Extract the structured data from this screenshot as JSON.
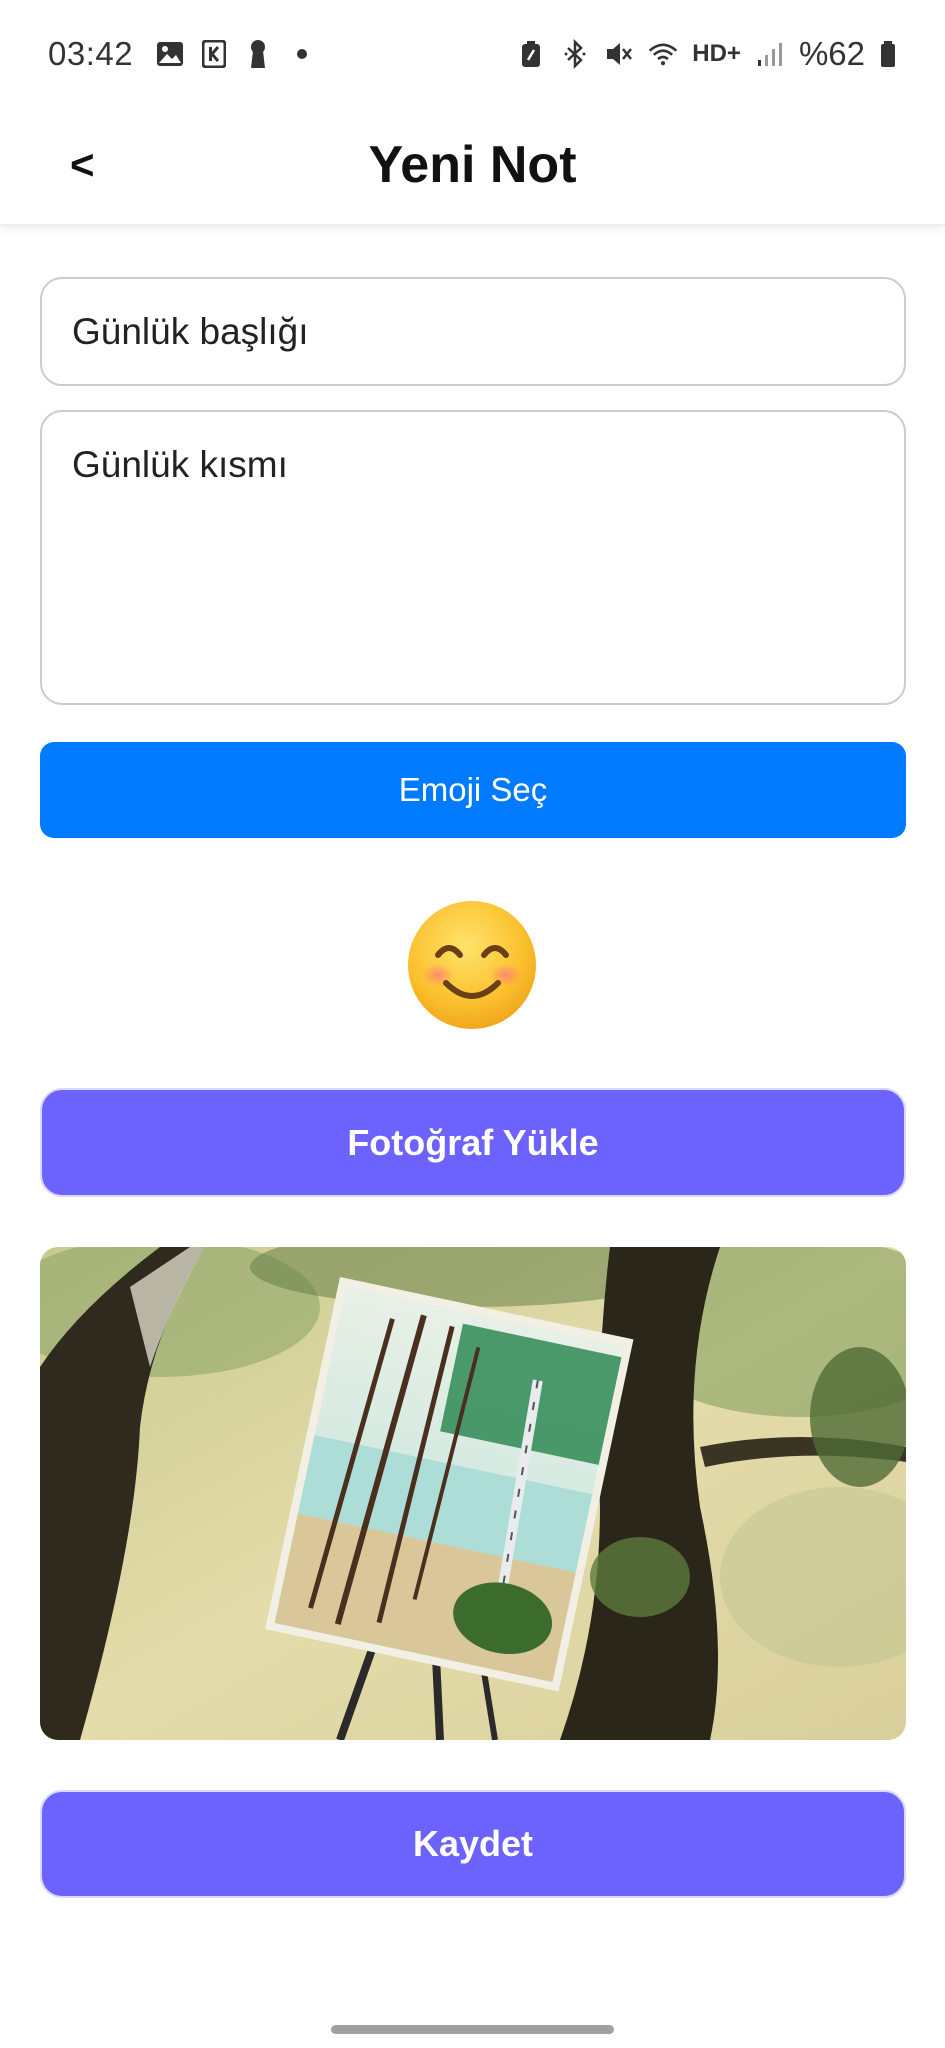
{
  "status_bar": {
    "time": "03:42",
    "battery": "%62",
    "hd_label": "HD+"
  },
  "header": {
    "back_label": "<",
    "title": "Yeni Not"
  },
  "form": {
    "title_placeholder": "Günlük başlığı",
    "body_placeholder": "Günlük kısmı"
  },
  "buttons": {
    "emoji": "Emoji Seç",
    "upload": "Fotoğraf Yükle",
    "save": "Kaydet"
  },
  "colors": {
    "emoji_button": "#007aff",
    "primary_button": "#6c63ff"
  },
  "icons": {
    "selected_emoji": "smiling-face-with-smiling-eyes"
  }
}
